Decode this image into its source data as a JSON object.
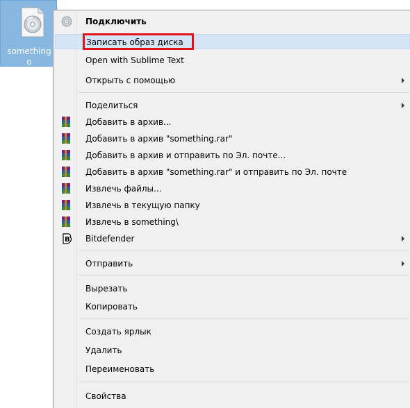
{
  "desktop": {
    "file": {
      "name": "somethingo",
      "name_line1": "something",
      "name_line2": "o",
      "icon": "disc-image-file-icon"
    }
  },
  "menu": {
    "items": [
      {
        "label": "Подключить",
        "icon": "disc-mount-icon",
        "bold": true
      },
      {
        "label": "Записать образ диска",
        "highlighted": true
      },
      {
        "label": "Open with Sublime Text"
      },
      {
        "label": "Открыть с помощью",
        "submenu": true
      },
      {
        "label": "Поделиться",
        "submenu": true
      },
      {
        "label": "Добавить в архив...",
        "icon": "winrar-icon"
      },
      {
        "label": "Добавить в архив \"something.rar\"",
        "icon": "winrar-icon"
      },
      {
        "label": "Добавить в архив и отправить по Эл. почте...",
        "icon": "winrar-icon"
      },
      {
        "label": "Добавить в архив \"something.rar\" и отправить по Эл. почте",
        "icon": "winrar-icon"
      },
      {
        "label": "Извлечь файлы...",
        "icon": "winrar-icon"
      },
      {
        "label": "Извлечь в текущую папку",
        "icon": "winrar-icon"
      },
      {
        "label": "Извлечь в something\\",
        "icon": "winrar-icon"
      },
      {
        "label": "Bitdefender",
        "icon": "bitdefender-icon",
        "submenu": true
      },
      {
        "label": "Отправить",
        "submenu": true
      },
      {
        "label": "Вырезать"
      },
      {
        "label": "Копировать"
      },
      {
        "label": "Создать ярлык"
      },
      {
        "label": "Удалить"
      },
      {
        "label": "Переименовать"
      },
      {
        "label": "Свойства"
      }
    ]
  },
  "colors": {
    "selection_fill": "#d5e5f5",
    "selection_border": "#c0d8f1",
    "annotation_red": "#e0131a",
    "file_selected_bg": "#88b8e0",
    "menu_bg": "#f0f0f0"
  }
}
